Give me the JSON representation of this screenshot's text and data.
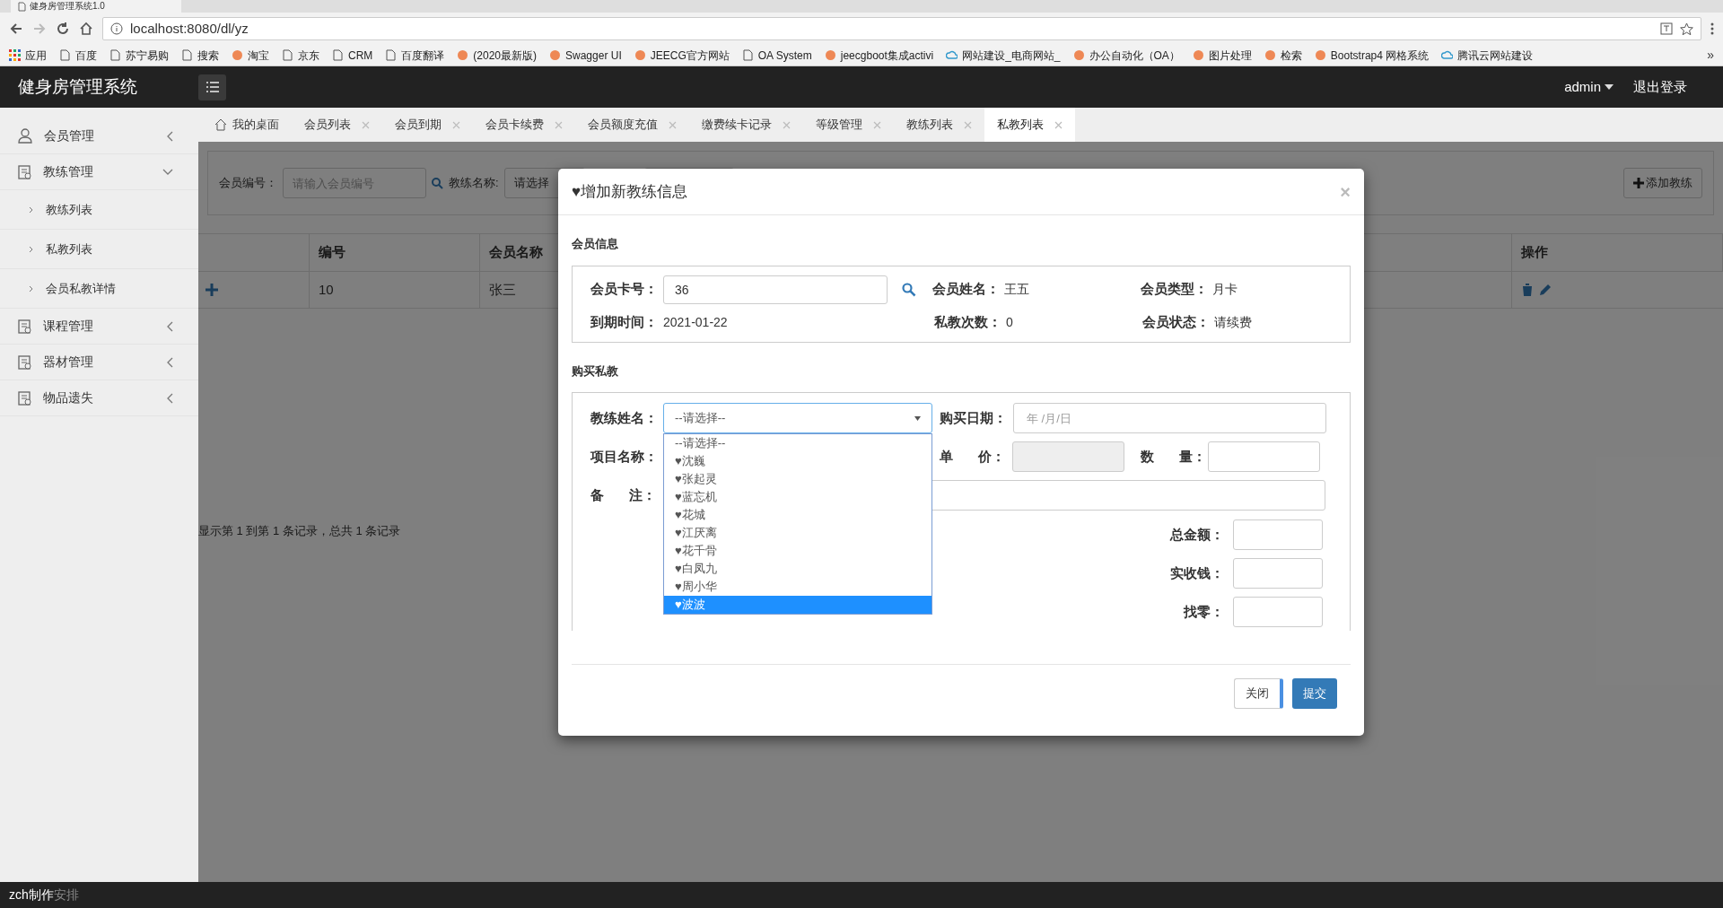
{
  "browser": {
    "tab_title": "健身房管理系统1.0",
    "url": "localhost:8080/dl/yz",
    "bookmarks": [
      {
        "label": "应用",
        "kind": "apps"
      },
      {
        "label": "百度",
        "kind": "page"
      },
      {
        "label": "苏宁易购",
        "kind": "page"
      },
      {
        "label": "搜索",
        "kind": "page"
      },
      {
        "label": "淘宝",
        "kind": "site"
      },
      {
        "label": "京东",
        "kind": "page"
      },
      {
        "label": "CRM",
        "kind": "page"
      },
      {
        "label": "百度翻译",
        "kind": "page"
      },
      {
        "label": "(2020最新版)",
        "kind": "site"
      },
      {
        "label": "Swagger UI",
        "kind": "site"
      },
      {
        "label": "JEECG官方网站",
        "kind": "site"
      },
      {
        "label": "OA System",
        "kind": "page"
      },
      {
        "label": "jeecgboot集成activi",
        "kind": "site"
      },
      {
        "label": "网站建设_电商网站_",
        "kind": "cloud"
      },
      {
        "label": "办公自动化（OA）",
        "kind": "site"
      },
      {
        "label": "图片处理",
        "kind": "site"
      },
      {
        "label": "检索",
        "kind": "site"
      },
      {
        "label": "Bootstrap4 网格系统",
        "kind": "site"
      },
      {
        "label": "腾讯云网站建设",
        "kind": "cloud"
      }
    ],
    "overflow": "»"
  },
  "header": {
    "title": "健身房管理系统",
    "user": "admin",
    "logout": "退出登录"
  },
  "sidebar": {
    "items": [
      {
        "label": "会员管理",
        "kind": "user",
        "expanded": false
      },
      {
        "label": "教练管理",
        "kind": "doc",
        "expanded": true,
        "children": [
          {
            "label": "教练列表"
          },
          {
            "label": "私教列表"
          },
          {
            "label": "会员私教详情"
          }
        ]
      },
      {
        "label": "课程管理",
        "kind": "doc",
        "expanded": false
      },
      {
        "label": "器材管理",
        "kind": "doc",
        "expanded": false
      },
      {
        "label": "物品遗失",
        "kind": "doc",
        "expanded": false
      }
    ]
  },
  "tabs": [
    {
      "label": "我的桌面",
      "closable": false,
      "selected": false
    },
    {
      "label": "会员列表",
      "closable": true,
      "selected": false
    },
    {
      "label": "会员到期",
      "closable": true,
      "selected": false
    },
    {
      "label": "会员卡续费",
      "closable": true,
      "selected": false
    },
    {
      "label": "会员额度充值",
      "closable": true,
      "selected": false
    },
    {
      "label": "缴费续卡记录",
      "closable": true,
      "selected": false
    },
    {
      "label": "等级管理",
      "closable": true,
      "selected": false
    },
    {
      "label": "教练列表",
      "closable": true,
      "selected": false
    },
    {
      "label": "私教列表",
      "closable": true,
      "selected": true
    }
  ],
  "search_panel": {
    "member_label": "会员编号：",
    "member_placeholder": "请输入会员编号",
    "coach_label": "教练名称:",
    "coach_value": "请选择",
    "add_button": "添加教练"
  },
  "table": {
    "columns": [
      {
        "label": "编号"
      },
      {
        "label": "会员名称"
      },
      {
        "label": "操作"
      }
    ],
    "rows": [
      {
        "cells": [
          "10",
          "张三"
        ]
      }
    ],
    "pagination": "显示第 1 到第 1 条记录，总共 1 条记录"
  },
  "modal": {
    "title": "♥增加新教练信息",
    "close_symbol": "×",
    "member_section": "会员信息",
    "card_label": "会员卡号：",
    "card_value": "36",
    "info": [
      {
        "label": "会员姓名：",
        "value": "王五"
      },
      {
        "label": "会员类型：",
        "value": "月卡"
      },
      {
        "label": "到期时间：",
        "value": "2021-01-22"
      },
      {
        "label": "私教次数：",
        "value": "0"
      },
      {
        "label": "会员状态：",
        "value": "请续费"
      }
    ],
    "buy_section": "购买私教",
    "coach_label": "教练姓名：",
    "coach_value": "--请选择--",
    "options": [
      {
        "label": "--请选择--",
        "selected": false
      },
      {
        "label": "♥沈巍",
        "selected": false
      },
      {
        "label": "♥张起灵",
        "selected": false
      },
      {
        "label": "♥蓝忘机",
        "selected": false
      },
      {
        "label": "♥花城",
        "selected": false
      },
      {
        "label": "♥江厌离",
        "selected": false
      },
      {
        "label": "♥花千骨",
        "selected": false
      },
      {
        "label": "♥白凤九",
        "selected": false
      },
      {
        "label": "♥周小华",
        "selected": false
      },
      {
        "label": "♥波波",
        "selected": true
      }
    ],
    "date_label": "购买日期：",
    "date_placeholder": "年 /月/日",
    "project_label": "项目名称：",
    "price_label": "单 价：",
    "qty_label": "数 量：",
    "note_label": "备 注：",
    "totals": [
      {
        "label": "总金额："
      },
      {
        "label": "实收钱："
      },
      {
        "label": "找零："
      }
    ],
    "close_button": "关闭",
    "submit_button": "提交"
  },
  "footer": {
    "text": "zch制作",
    "faint": "安排"
  }
}
